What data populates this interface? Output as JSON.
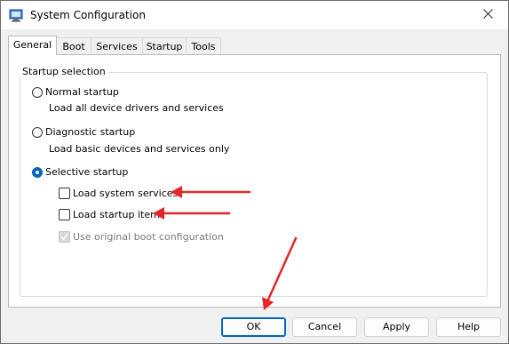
{
  "window": {
    "title": "System Configuration",
    "close_icon": "close-icon",
    "app_icon": "computer-settings-icon"
  },
  "tabs": [
    {
      "label": "General",
      "active": true
    },
    {
      "label": "Boot",
      "active": false
    },
    {
      "label": "Services",
      "active": false
    },
    {
      "label": "Startup",
      "active": false
    },
    {
      "label": "Tools",
      "active": false
    }
  ],
  "startup_selection": {
    "legend": "Startup selection",
    "normal": {
      "label": "Normal startup",
      "description": "Load all device drivers and services",
      "checked": false
    },
    "diagnostic": {
      "label": "Diagnostic startup",
      "description": "Load basic devices and services only",
      "checked": false
    },
    "selective": {
      "label": "Selective startup",
      "checked": true,
      "options": [
        {
          "label": "Load system services",
          "checked": false,
          "enabled": true
        },
        {
          "label": "Load startup items",
          "checked": false,
          "enabled": true
        },
        {
          "label": "Use original boot configuration",
          "checked": true,
          "enabled": false
        }
      ]
    }
  },
  "buttons": {
    "ok": "OK",
    "cancel": "Cancel",
    "apply": "Apply",
    "help": "Help"
  },
  "colors": {
    "accent": "#0067c0",
    "annotation_arrow": "#e3262b"
  }
}
